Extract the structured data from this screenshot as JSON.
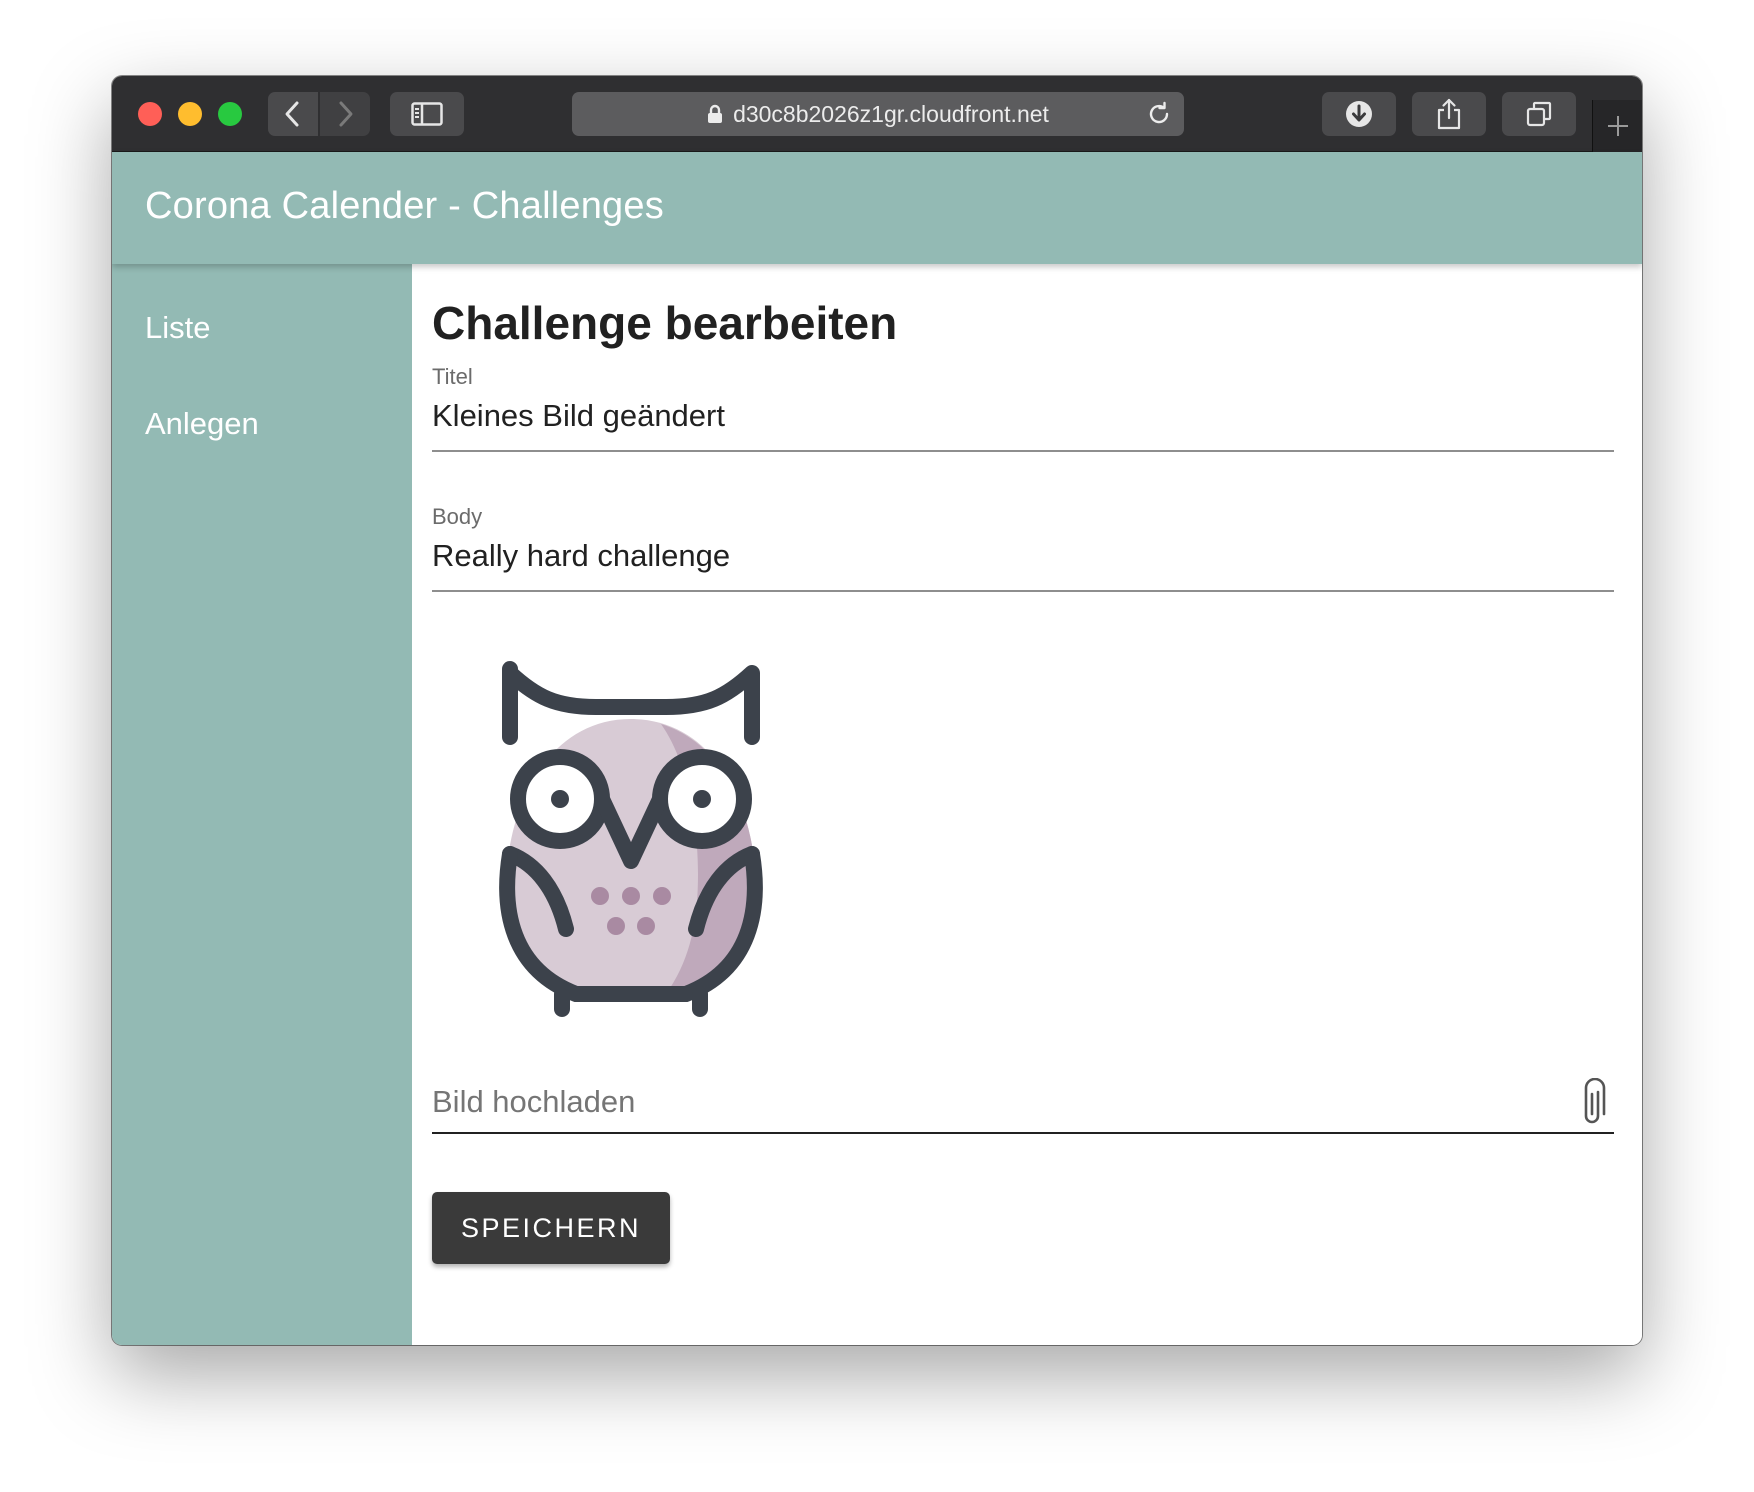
{
  "browser": {
    "url": "d30c8b2026z1gr.cloudfront.net",
    "icons": [
      "back-icon",
      "forward-icon",
      "sidebar-icon",
      "lock-icon",
      "reload-icon",
      "download-icon",
      "share-icon",
      "tabs-icon",
      "new-tab-icon"
    ]
  },
  "app": {
    "title": "Corona Calender - Challenges",
    "theme_color": "#93bab4"
  },
  "sidebar": {
    "items": [
      {
        "label": "Liste"
      },
      {
        "label": "Anlegen"
      }
    ]
  },
  "form": {
    "heading": "Challenge bearbeiten",
    "title_field": {
      "label": "Titel",
      "value": "Kleines Bild geändert"
    },
    "body_field": {
      "label": "Body",
      "value": "Really hard challenge"
    },
    "image": {
      "icon": "owl-icon"
    },
    "upload": {
      "placeholder": "Bild hochladen",
      "icon": "paperclip-icon"
    },
    "save_label": "SPEICHERN"
  }
}
